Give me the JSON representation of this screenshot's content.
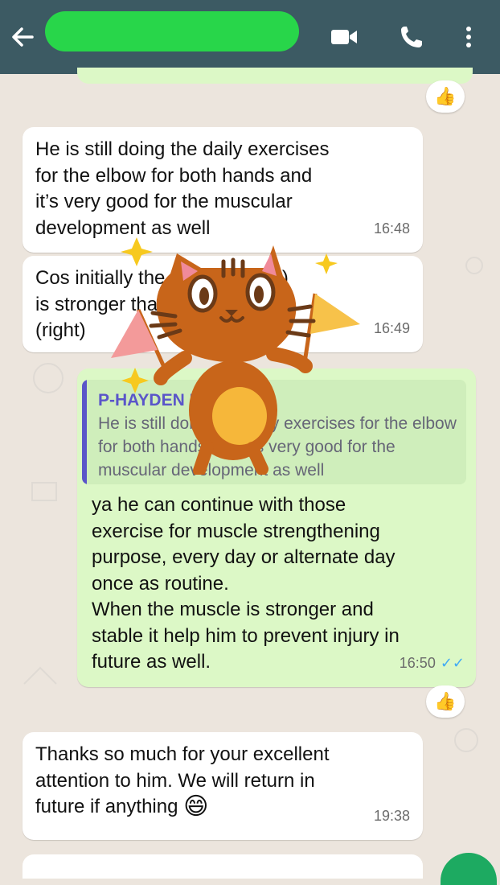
{
  "header": {
    "contact_name": "",
    "icons": [
      "back-arrow-icon",
      "video-call-icon",
      "phone-icon",
      "more-vert-icon"
    ]
  },
  "messages": [
    {
      "direction": "incoming",
      "text": "He is still doing the daily exercises\nfor the elbow for both hands and\nit’s very good for the muscular\ndevelopment as well",
      "time": "16:48"
    },
    {
      "direction": "incoming",
      "text": "Cos initially the left hand (left)\nis stronger than the right hand\n(right)",
      "time": "16:49"
    },
    {
      "direction": "outgoing",
      "quote": {
        "author": "P-HAYDEN L",
        "text": "He is still doing the daily exercises for the elbow for both hands and it’s very good for the muscular development as well"
      },
      "text": "ya he can continue with those\nexercise for muscle strengthening\npurpose, every day or alternate day\nonce as routine.\nWhen the muscle is stronger and\nstable it help him to prevent injury in\nfuture as well.",
      "time": "16:50",
      "ticks": "✓✓"
    },
    {
      "direction": "incoming",
      "text": "Thanks so much for your excellent\nattention to him. We will return in\nfuture if anything",
      "emoji": "😄",
      "time": "19:38"
    }
  ],
  "reactions": {
    "top": "👍",
    "after_reply": "👍"
  },
  "sticker": {
    "name": "cat-with-flags-sticker",
    "colors": {
      "body": "#c8651a",
      "belly": "#f6b73a",
      "flag_left": "#f39a9a",
      "flag_right": "#f7c24a",
      "sparkle": "#f7c91f"
    }
  },
  "theme": {
    "header_bg": "#3c5a63",
    "incoming_bg": "#ffffff",
    "outgoing_bg": "#dcf8c6",
    "read_ticks": "#3fa9f5",
    "reply_accent": "#5a55c9"
  }
}
